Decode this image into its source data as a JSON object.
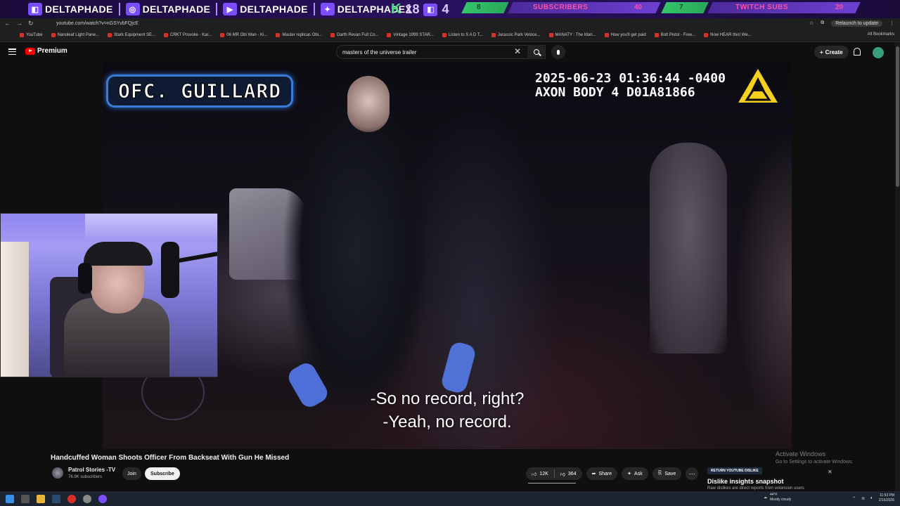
{
  "overlay": {
    "handles": [
      "DELTAPHADE",
      "DELTAPHADE",
      "DELTAPHADE",
      "DELTAPHADEX"
    ],
    "kick_count": "18",
    "twitch_count": "4",
    "subscribers_current": "8",
    "subscribers_label": "SUBSCRIBERS",
    "subscribers_goal": "40",
    "twitch_subs_current": "7",
    "twitch_subs_label": "TWITCH SUBS",
    "twitch_subs_goal": "20"
  },
  "browser": {
    "url": "youtube.com/watch?v=nGSYvbFQjcE",
    "relaunch": "Relaunch to update",
    "bookmarks": [
      "YouTube",
      "Nanoleaf Light Pane...",
      "Stark Equipment SE...",
      "CRKT Provoke - Kar...",
      "06 MR Obi Wan - Ki...",
      "Master replicas Obi...",
      "Darth Revan Full Co...",
      "Vintage 1999 STAR...",
      "Listen to S A D T...",
      "Jurassic Park Veloce...",
      "MANATY : The Man...",
      "How you'll get paid",
      "Bolt Pistol - Free...",
      "Now HEAR this! We..."
    ],
    "all_bookmarks": "All Bookmarks"
  },
  "youtube": {
    "logo_text": "Premium",
    "search_value": "masters of the universe trailer",
    "create_label": "Create"
  },
  "video": {
    "name_tag": "OFC. GUILLARD",
    "cam_datetime": "2025-06-23 01:36:44 -0400",
    "cam_device": "AXON BODY 4 D01A81866",
    "subtitle_line1": "-So no record, right?",
    "subtitle_line2": "-Yeah, no record.",
    "title": "Handcuffed Woman Shoots Officer From Backseat With Gun He Missed"
  },
  "channel": {
    "name": "Patrol Stories -TV",
    "subscribers": "76.9K subscribers",
    "join_label": "Join",
    "subscribe_label": "Subscribe"
  },
  "actions": {
    "likes": "12K",
    "dislikes": "364",
    "share": "Share",
    "ask": "Ask",
    "save": "Save"
  },
  "ryd": {
    "tag": "RETURN YOUTUBE DISLIKE",
    "title": "Dislike insights snapshot",
    "subtitle": "Raw dislikes are direct reports from extension users"
  },
  "windows": {
    "activate_title": "Activate Windows",
    "activate_sub": "Go to Settings to activate Windows.",
    "weather_temp": "44°F",
    "weather_desc": "Mostly cloudy",
    "time": "11:53 PM",
    "date": "2/16/2026"
  },
  "colors": {
    "overlay_accent": "#7b4dff",
    "overlay_pink": "#ff4fa8",
    "kick_green": "#3fe070",
    "yt_red": "#ff0000",
    "name_tag_border": "#3a7bd6"
  }
}
